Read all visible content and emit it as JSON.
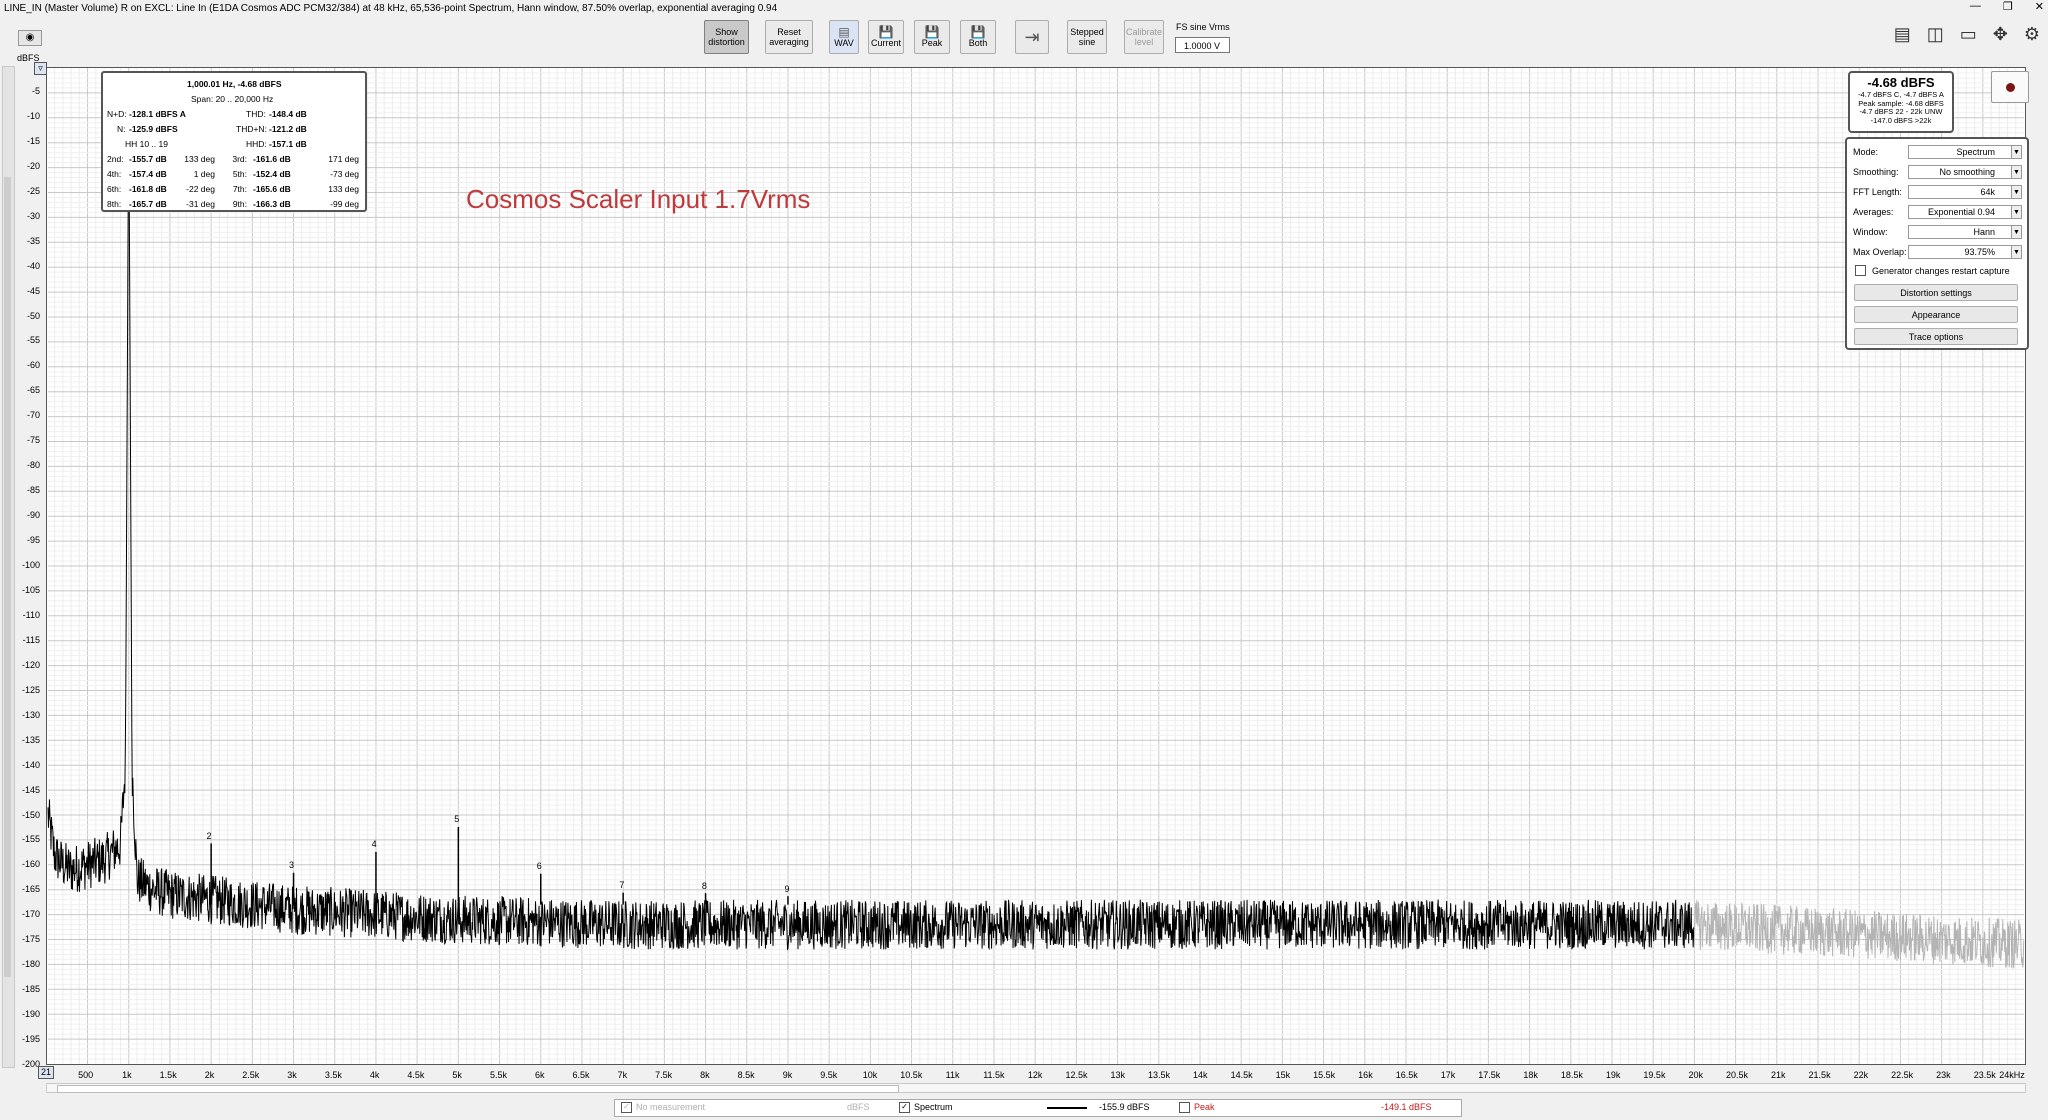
{
  "title": "LINE_IN (Master Volume) R on EXCL: Line In (E1DA Cosmos ADC PCM32/384) at 48 kHz, 65,536-point Spectrum, Hann window, 87.50% overlap, exponential averaging 0.94",
  "toolbar": {
    "show_distortion": [
      "Show",
      "distortion"
    ],
    "reset_averaging": [
      "Reset",
      "averaging"
    ],
    "wav": "WAV",
    "current": "Current",
    "peak": "Peak",
    "both": "Both",
    "stepped_sine": [
      "Stepped",
      "sine"
    ],
    "calibrate_level": [
      "Calibrate",
      "level"
    ],
    "fs_label": "FS sine Vrms",
    "fs_value": "1.0000 V"
  },
  "y_unit": "dBFS",
  "x_start_box": "21",
  "distortion": {
    "header": "1,000.01 Hz, -4.68 dBFS",
    "span": "Span: 20 .. 20,000 Hz",
    "nd_label": "N+D:",
    "nd_value": "-128.1 dBFS A",
    "thd_label": "THD:",
    "thd_value": "-148.4 dB",
    "n_label": "N:",
    "n_value": "-125.9 dBFS",
    "thdn_label": "THD+N:",
    "thdn_value": "-121.2 dB",
    "hh_label": "HH 10 .. 19",
    "hhd_label": "HHD:",
    "hhd_value": "-157.1 dB",
    "harmonics": [
      {
        "l1": "2nd:",
        "v1": "-155.7 dB",
        "p1": "133 deg",
        "l2": "3rd:",
        "v2": "-161.6 dB",
        "p2": "171 deg"
      },
      {
        "l1": "4th:",
        "v1": "-157.4 dB",
        "p1": "1 deg",
        "l2": "5th:",
        "v2": "-152.4 dB",
        "p2": "-73 deg"
      },
      {
        "l1": "6th:",
        "v1": "-161.8 dB",
        "p1": "-22 deg",
        "l2": "7th:",
        "v2": "-165.6 dB",
        "p2": "133 deg"
      },
      {
        "l1": "8th:",
        "v1": "-165.7 dB",
        "p1": "-31 deg",
        "l2": "9th:",
        "v2": "-166.3 dB",
        "p2": "-99 deg"
      }
    ]
  },
  "annotation": "Cosmos Scaler Input 1.7Vrms",
  "level": {
    "big": "-4.68 dBFS",
    "line1": "-4.7 dBFS C, -4.7 dBFS A",
    "line2": "Peak sample: -4.68 dBFS",
    "line3": "-4.7 dBFS 22 - 22k UNW",
    "line4": "-147.0 dBFS >22k"
  },
  "controls": {
    "mode": {
      "label": "Mode:",
      "value": "Spectrum"
    },
    "smoothing": {
      "label": "Smoothing:",
      "value": "No smoothing"
    },
    "fft_length": {
      "label": "FFT Length:",
      "value": "64k"
    },
    "averages": {
      "label": "Averages:",
      "value": "Exponential 0.94"
    },
    "window": {
      "label": "Window:",
      "value": "Hann"
    },
    "max_overlap": {
      "label": "Max Overlap:",
      "value": "93.75%"
    },
    "generator_check": "Generator changes restart capture",
    "distortion_settings": "Distortion settings",
    "appearance": "Appearance",
    "trace_options": "Trace options"
  },
  "legend": {
    "no_measurement": "No measurement",
    "no_measurement_unit": "dBFS",
    "spectrum": "Spectrum",
    "spectrum_value": "-155.9 dBFS",
    "peak": "Peak",
    "peak_value": "-149.1 dBFS"
  },
  "chart_data": {
    "type": "line",
    "ylabel": "dBFS",
    "xlim": [
      20,
      24000
    ],
    "ylim": [
      -200,
      0
    ],
    "grid": true,
    "y_ticks": [
      "-5",
      "-10",
      "-15",
      "-20",
      "-25",
      "-30",
      "-35",
      "-40",
      "-45",
      "-50",
      "-55",
      "-60",
      "-65",
      "-70",
      "-75",
      "-80",
      "-85",
      "-90",
      "-95",
      "-100",
      "-105",
      "-110",
      "-115",
      "-120",
      "-125",
      "-130",
      "-135",
      "-140",
      "-145",
      "-150",
      "-155",
      "-160",
      "-165",
      "-170",
      "-175",
      "-180",
      "-185",
      "-190",
      "-195",
      "-200"
    ],
    "x_ticks": [
      {
        "v": 500,
        "t": "500"
      },
      {
        "v": 1000,
        "t": "1k"
      },
      {
        "v": 1500,
        "t": "1.5k"
      },
      {
        "v": 2000,
        "t": "2k"
      },
      {
        "v": 2500,
        "t": "2.5k"
      },
      {
        "v": 3000,
        "t": "3k"
      },
      {
        "v": 3500,
        "t": "3.5k"
      },
      {
        "v": 4000,
        "t": "4k"
      },
      {
        "v": 4500,
        "t": "4.5k"
      },
      {
        "v": 5000,
        "t": "5k"
      },
      {
        "v": 5500,
        "t": "5.5k"
      },
      {
        "v": 6000,
        "t": "6k"
      },
      {
        "v": 6500,
        "t": "6.5k"
      },
      {
        "v": 7000,
        "t": "7k"
      },
      {
        "v": 7500,
        "t": "7.5k"
      },
      {
        "v": 8000,
        "t": "8k"
      },
      {
        "v": 8500,
        "t": "8.5k"
      },
      {
        "v": 9000,
        "t": "9k"
      },
      {
        "v": 9500,
        "t": "9.5k"
      },
      {
        "v": 10000,
        "t": "10k"
      },
      {
        "v": 10500,
        "t": "10.5k"
      },
      {
        "v": 11000,
        "t": "11k"
      },
      {
        "v": 11500,
        "t": "11.5k"
      },
      {
        "v": 12000,
        "t": "12k"
      },
      {
        "v": 12500,
        "t": "12.5k"
      },
      {
        "v": 13000,
        "t": "13k"
      },
      {
        "v": 13500,
        "t": "13.5k"
      },
      {
        "v": 14000,
        "t": "14k"
      },
      {
        "v": 14500,
        "t": "14.5k"
      },
      {
        "v": 15000,
        "t": "15k"
      },
      {
        "v": 15500,
        "t": "15.5k"
      },
      {
        "v": 16000,
        "t": "16k"
      },
      {
        "v": 16500,
        "t": "16.5k"
      },
      {
        "v": 17000,
        "t": "17k"
      },
      {
        "v": 17500,
        "t": "17.5k"
      },
      {
        "v": 18000,
        "t": "18k"
      },
      {
        "v": 18500,
        "t": "18.5k"
      },
      {
        "v": 19000,
        "t": "19k"
      },
      {
        "v": 19500,
        "t": "19.5k"
      },
      {
        "v": 20000,
        "t": "20k"
      },
      {
        "v": 20500,
        "t": "20.5k"
      },
      {
        "v": 21000,
        "t": "21k"
      },
      {
        "v": 21500,
        "t": "21.5k"
      },
      {
        "v": 22000,
        "t": "22k"
      },
      {
        "v": 22500,
        "t": "22.5k"
      },
      {
        "v": 23000,
        "t": "23k"
      },
      {
        "v": 23500,
        "t": "23.5k"
      },
      {
        "v": 24000,
        "t": "24kHz"
      }
    ],
    "series": [
      {
        "name": "Spectrum",
        "color": "#000000",
        "x": [
          20,
          100,
          200,
          300,
          500,
          700,
          900,
          960,
          1000,
          1040,
          1100,
          1300,
          1500,
          2000,
          3000,
          4000,
          5000,
          7000,
          10000,
          15000,
          20000
        ],
        "y": [
          -150,
          -158,
          -160,
          -161,
          -160,
          -159,
          -156,
          -140,
          -4.68,
          -140,
          -163,
          -165,
          -166,
          -167,
          -169,
          -170,
          -171,
          -172,
          -172,
          -172,
          -172
        ]
      },
      {
        "name": "beyond-20k",
        "color": "#b4b4b4",
        "x": [
          20000,
          22000,
          24000
        ],
        "y": [
          -172,
          -174,
          -176
        ]
      }
    ],
    "harmonic_markers": [
      {
        "label": "2",
        "x": 2000,
        "y": -155.7
      },
      {
        "label": "3",
        "x": 3000,
        "y": -161.6
      },
      {
        "label": "4",
        "x": 4000,
        "y": -157.4
      },
      {
        "label": "5",
        "x": 5000,
        "y": -152.4
      },
      {
        "label": "6",
        "x": 6000,
        "y": -161.8
      },
      {
        "label": "7",
        "x": 7000,
        "y": -165.6
      },
      {
        "label": "8",
        "x": 8000,
        "y": -165.7
      },
      {
        "label": "9",
        "x": 9000,
        "y": -166.3
      }
    ],
    "noise_floor_spread_db": 5
  }
}
